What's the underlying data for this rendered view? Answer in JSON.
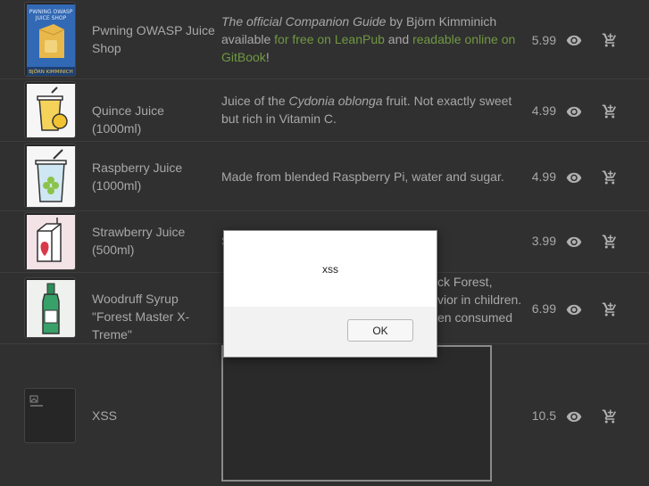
{
  "products": [
    {
      "name": "Pwning OWASP Juice Shop",
      "desc_parts": [
        {
          "text": "The official Companion Guide",
          "style": "italic"
        },
        {
          "text": " by Björn Kimminich available ",
          "style": "plain"
        },
        {
          "text": "for free on LeanPub",
          "style": "link"
        },
        {
          "text": " and ",
          "style": "plain"
        },
        {
          "text": "readable online on GitBook",
          "style": "link"
        },
        {
          "text": "!",
          "style": "plain"
        }
      ],
      "price": "5.99",
      "image_icon": "book-cover-icon"
    },
    {
      "name": "Quince Juice (1000ml)",
      "desc_parts": [
        {
          "text": "Juice of the ",
          "style": "plain"
        },
        {
          "text": "Cydonia oblonga",
          "style": "italic"
        },
        {
          "text": " fruit. Not exactly sweet but rich in Vitamin C.",
          "style": "plain"
        }
      ],
      "price": "4.99",
      "image_icon": "quince-juice-icon"
    },
    {
      "name": "Raspberry Juice (1000ml)",
      "desc_parts": [
        {
          "text": "Made from blended Raspberry Pi, water and sugar.",
          "style": "plain"
        }
      ],
      "price": "4.99",
      "image_icon": "raspberry-juice-icon"
    },
    {
      "name": "Strawberry Juice (500ml)",
      "desc_parts": [
        {
          "text": "S",
          "style": "plain"
        }
      ],
      "price": "3.99",
      "image_icon": "strawberry-carton-icon"
    },
    {
      "name": "Woodruff Syrup \"Forest Master X-Treme\"",
      "desc_parts": [
        {
          "text": "ck Forest,",
          "style": "plain"
        },
        {
          "text": "vior in children.",
          "style": "plain"
        },
        {
          "text": "en consumed",
          "style": "plain"
        }
      ],
      "price": "6.99",
      "image_icon": "syrup-bottle-icon"
    },
    {
      "name": "XSS",
      "desc_parts": [],
      "price": "10.5",
      "image_icon": "broken-image-icon"
    }
  ],
  "dialog": {
    "message": "xss",
    "ok_label": "OK"
  },
  "colors": {
    "background": "#303030",
    "text": "#a8a8a8",
    "link": "#8bc34a",
    "icon": "#b0b0b0"
  }
}
